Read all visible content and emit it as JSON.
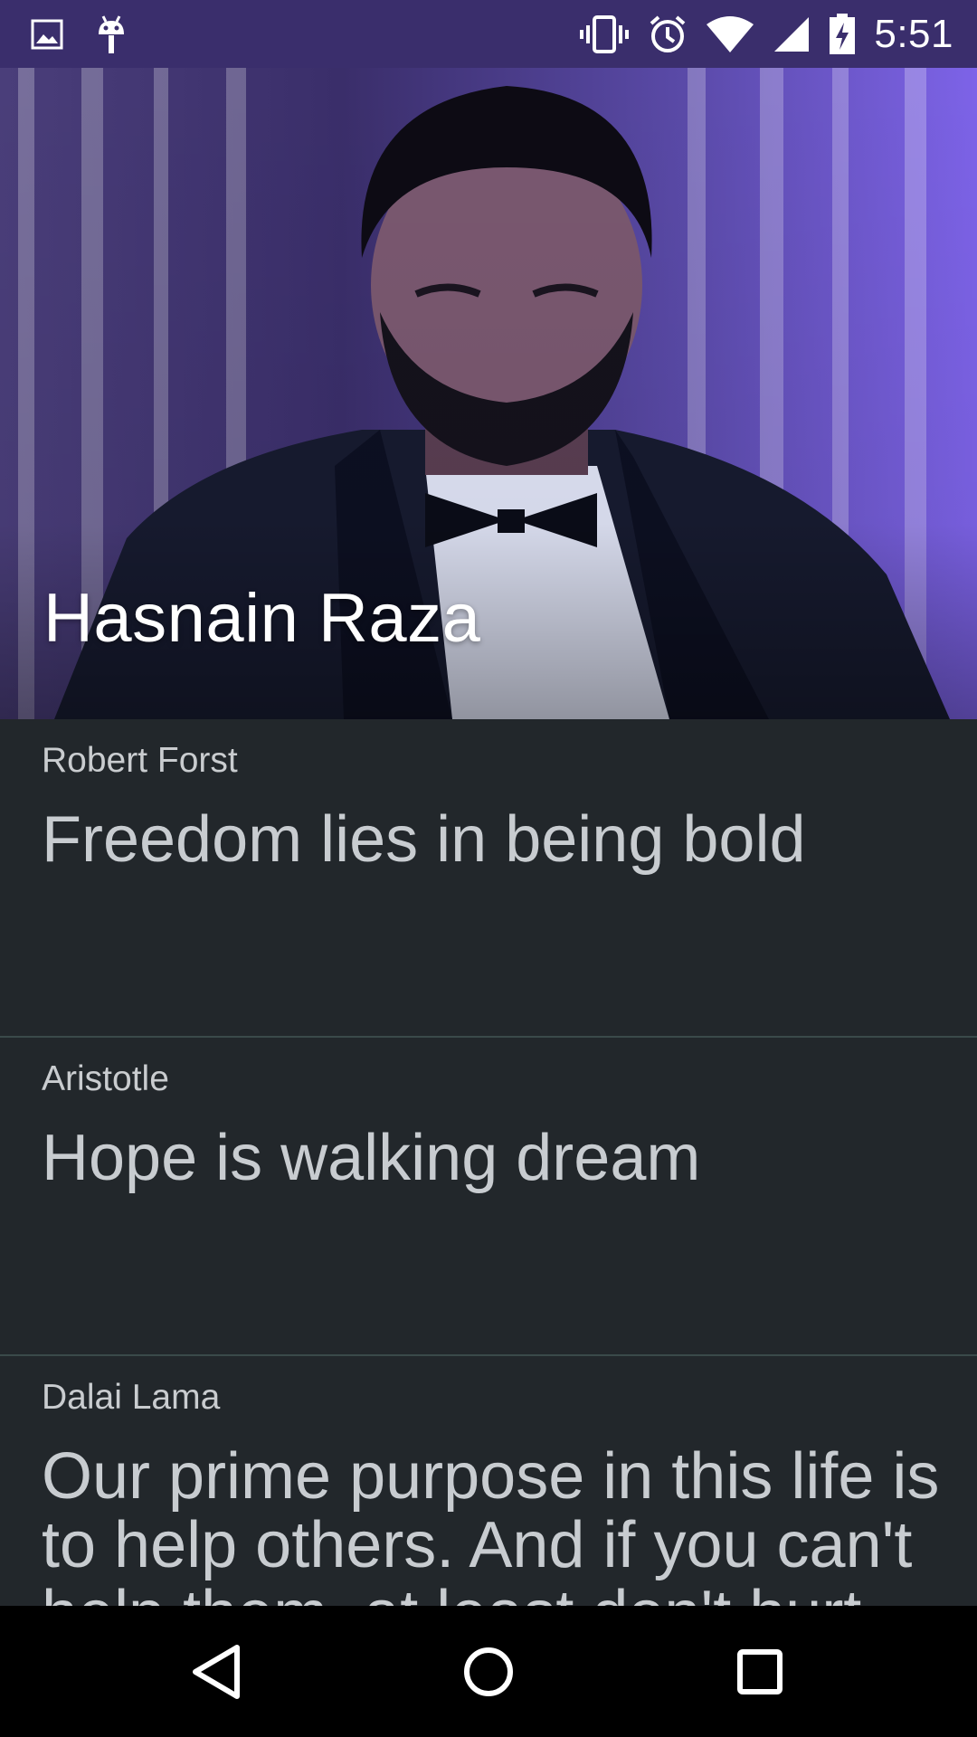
{
  "status_bar": {
    "time": "5:51",
    "left_icons": [
      "image-icon",
      "android-debug-icon"
    ],
    "right_icons": [
      "vibrate-icon",
      "alarm-icon",
      "wifi-icon",
      "cell-signal-icon",
      "battery-charging-icon"
    ],
    "background": "#3a2e6c"
  },
  "header": {
    "title": "Hasnain Raza",
    "image": "profile-photo"
  },
  "quotes": [
    {
      "author": "Robert Forst",
      "text": "Freedom lies in being bold"
    },
    {
      "author": "Aristotle",
      "text": "Hope is walking dream"
    },
    {
      "author": "Dalai Lama",
      "text": "Our prime purpose in this life is to help others. And if you can't help them, at least don't hurt them."
    }
  ],
  "nav_bar": {
    "buttons": [
      "back-icon",
      "home-icon",
      "recents-icon"
    ]
  },
  "colors": {
    "list_background": "#22272b",
    "divider": "#3a4a4a",
    "text": "#c8ccd0"
  }
}
